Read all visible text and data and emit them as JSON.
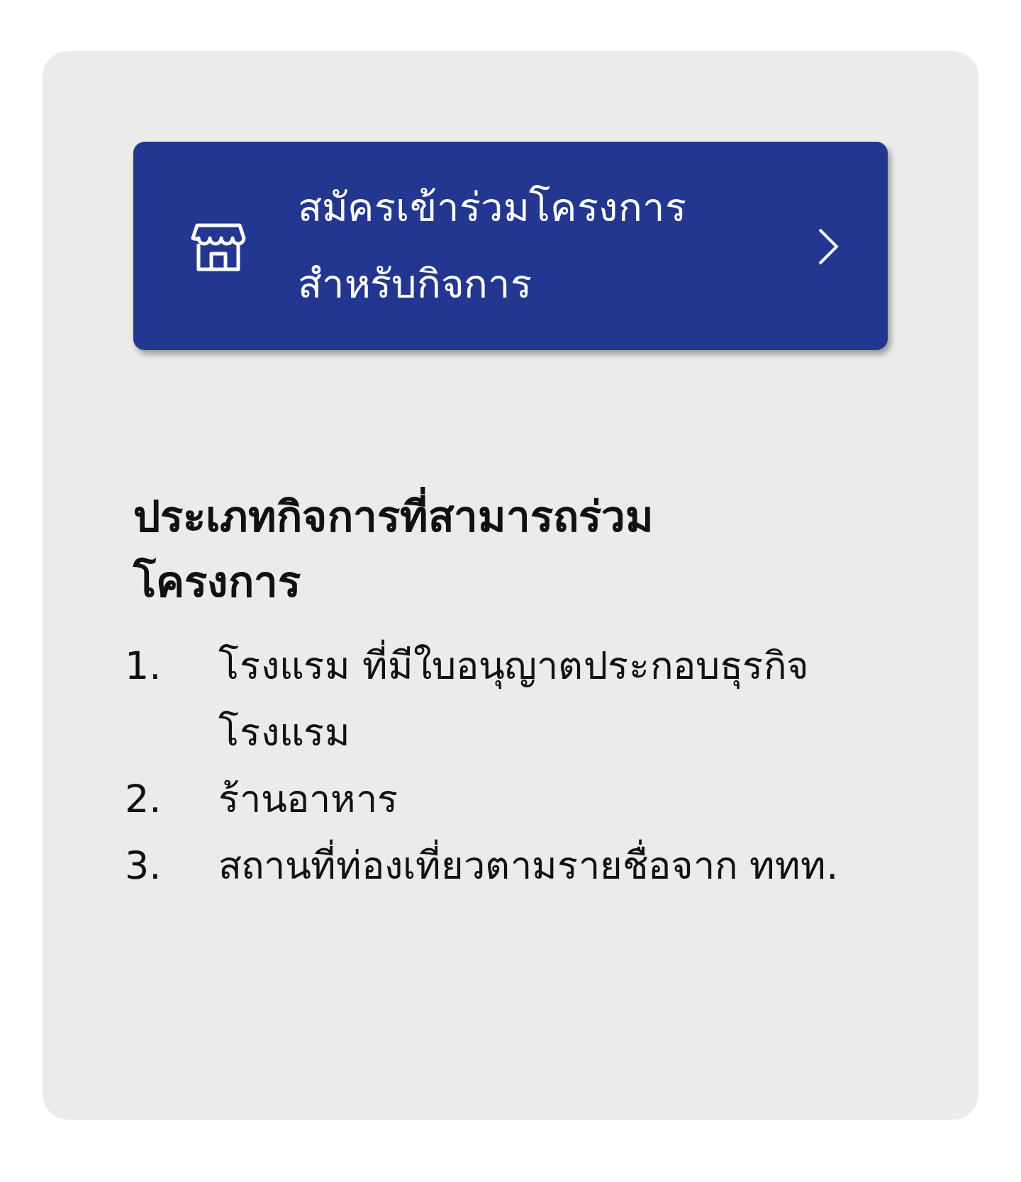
{
  "register_button": {
    "label": "สมัครเข้าร่วมโครงการสำหรับกิจการ"
  },
  "eligible": {
    "heading": "ประเภทกิจการที่สามารถร่วมโครงการ",
    "items": [
      {
        "number": "1.",
        "text": "โรงแรม ที่มีใบอนุญาตประกอบธุรกิจโรงแรม"
      },
      {
        "number": "2.",
        "text": "ร้านอาหาร"
      },
      {
        "number": "3.",
        "text": "สถานที่ท่องเที่ยวตามรายชื่อจาก ททท."
      }
    ]
  }
}
